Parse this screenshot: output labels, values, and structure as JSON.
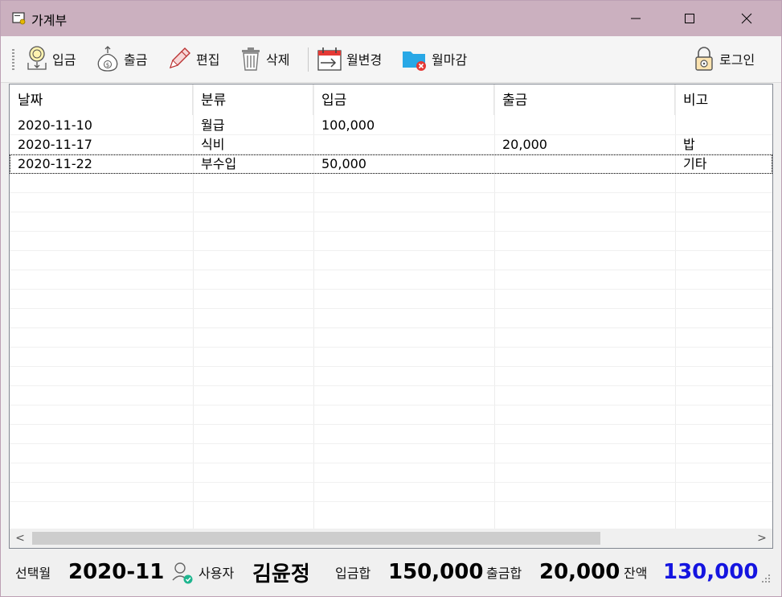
{
  "window": {
    "title": "가계부",
    "minimize": "─",
    "maximize": "☐",
    "close": "✕"
  },
  "toolbar": {
    "items": [
      {
        "label": "입금",
        "icon": "deposit-coin-icon"
      },
      {
        "label": "출금",
        "icon": "withdraw-moneybag-icon"
      },
      {
        "label": "편집",
        "icon": "pencil-icon"
      },
      {
        "label": "삭제",
        "icon": "trash-icon"
      },
      {
        "label": "월변경",
        "icon": "calendar-change-icon"
      },
      {
        "label": "월마감",
        "icon": "folder-close-icon"
      },
      {
        "label": "로그인",
        "icon": "lock-icon"
      }
    ]
  },
  "table": {
    "columns": [
      "날짜",
      "분류",
      "입금",
      "출금",
      "비고"
    ],
    "rows": [
      [
        "2020-11-10",
        "월급",
        "100,000",
        "",
        ""
      ],
      [
        "2020-11-17",
        "식비",
        "",
        "20,000",
        "밥"
      ],
      [
        "2020-11-22",
        "부수입",
        "50,000",
        "",
        "기타"
      ]
    ],
    "scroll_left": "<",
    "scroll_right": ">"
  },
  "status": {
    "month_label": "선택월",
    "month_value": "2020-11",
    "user_label": "사용자",
    "user_value": "김윤정",
    "income_label": "입금합",
    "income_value": "150,000",
    "expense_label": "출금합",
    "expense_value": "20,000",
    "balance_label": "잔액",
    "balance_value": "130,000",
    "balance_color": "#1515e0"
  }
}
